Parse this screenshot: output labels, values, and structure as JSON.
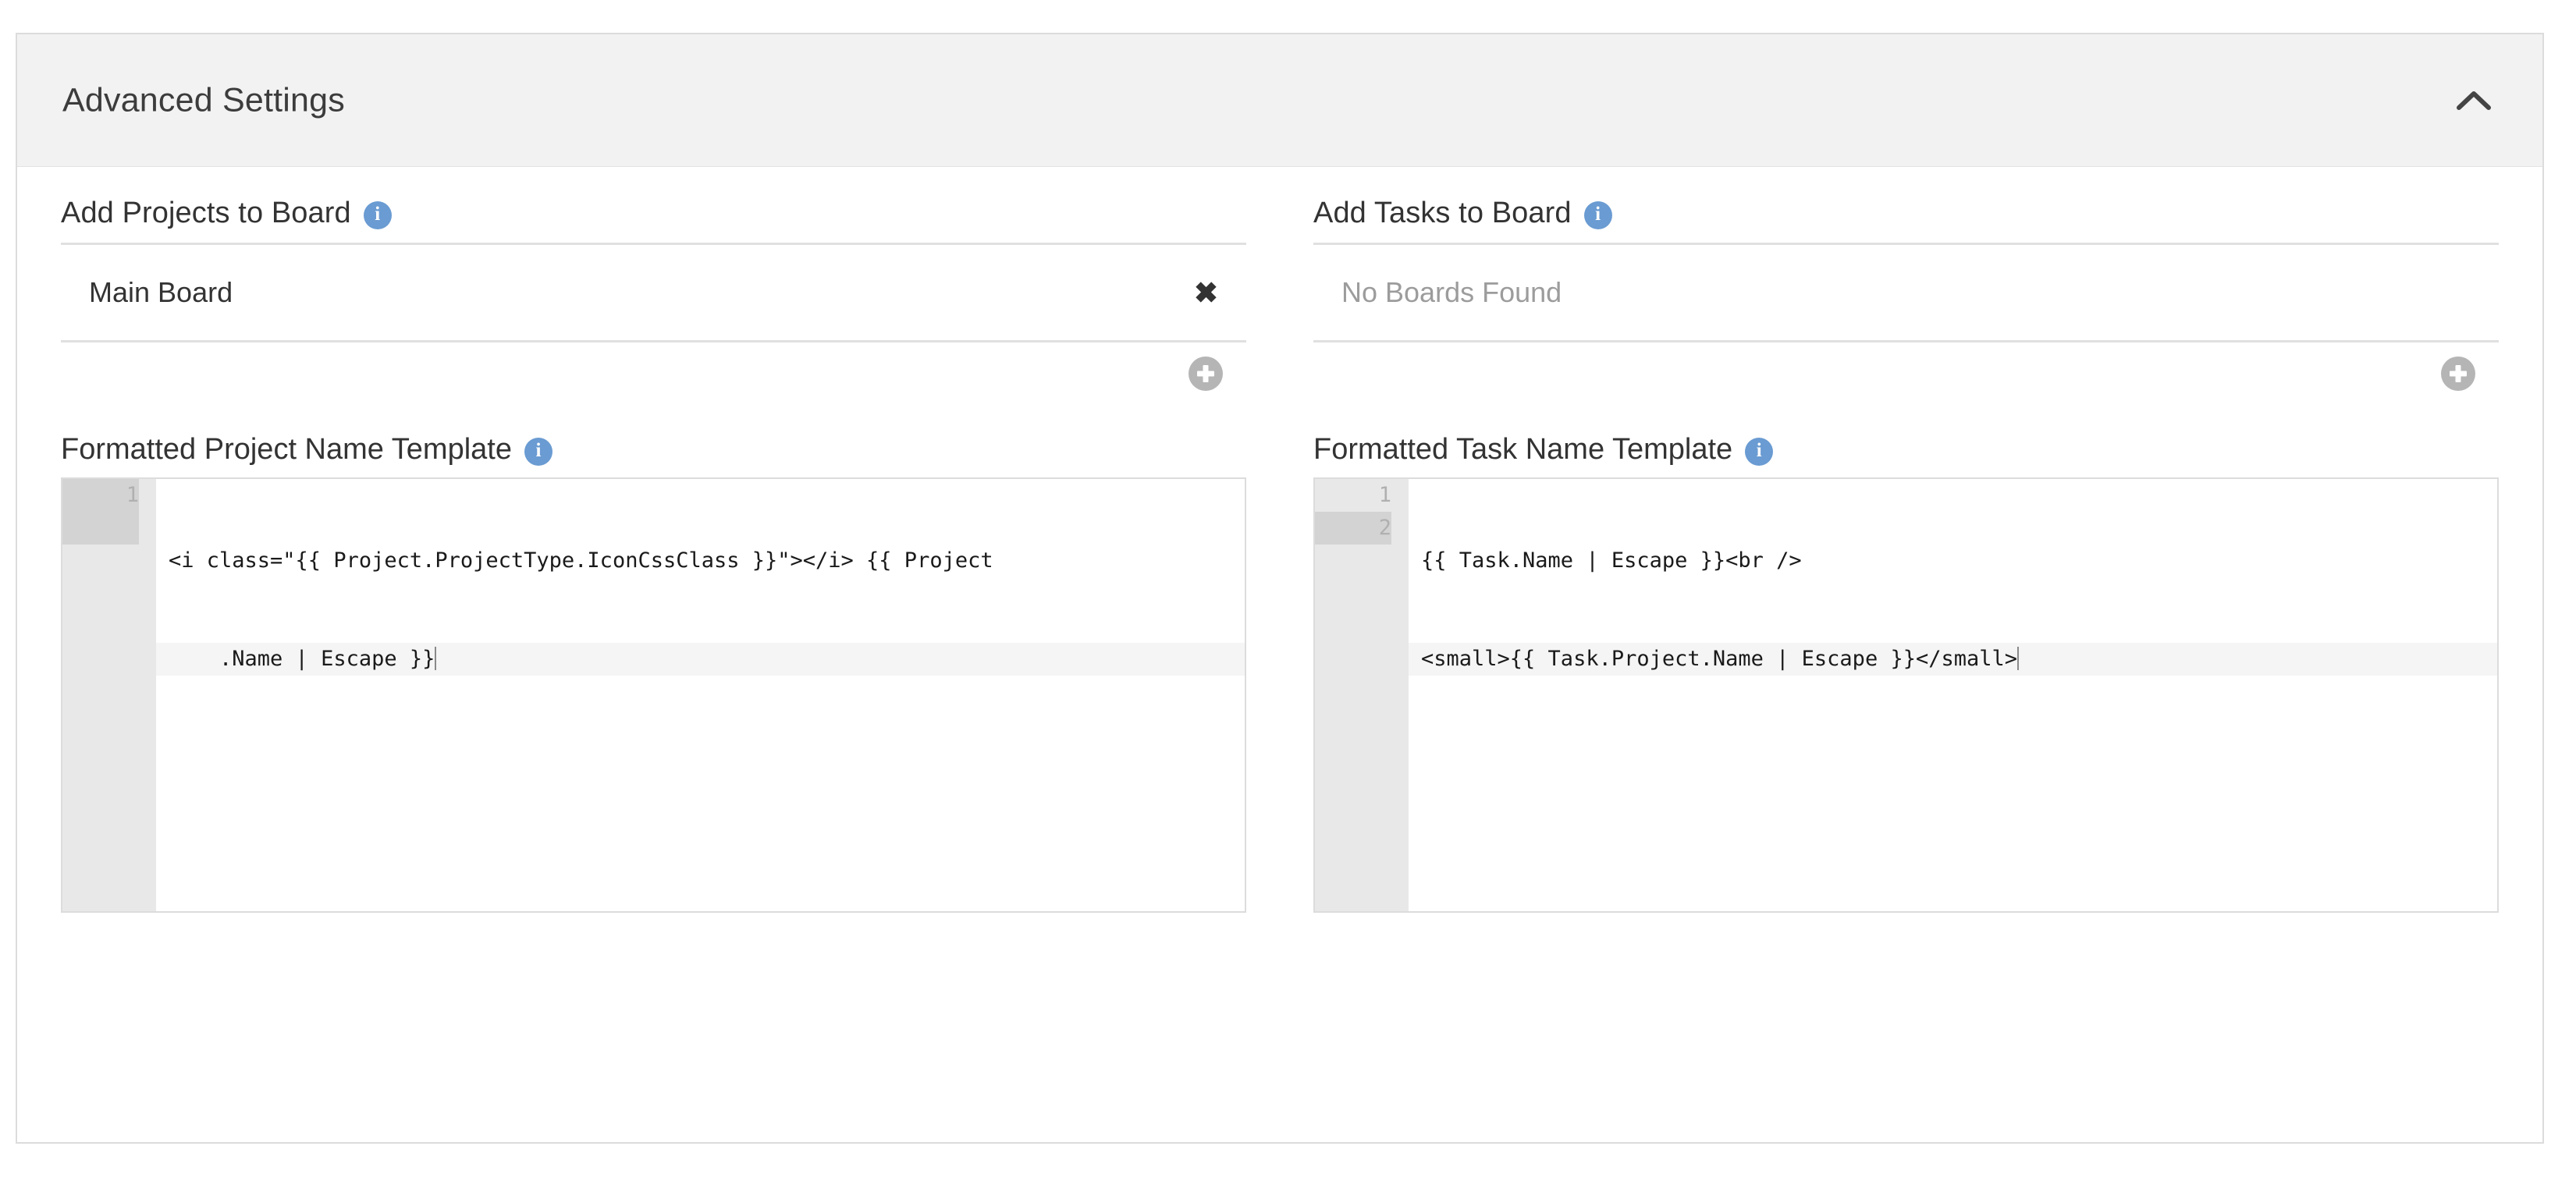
{
  "card": {
    "header": {
      "title": "Advanced Settings",
      "collapse_icon": "chevron-up-icon"
    }
  },
  "projects_section": {
    "title": "Add Projects to Board",
    "info_icon": "info-icon",
    "info_glyph": "i",
    "rows": [
      {
        "name": "Main Board",
        "remove_label": "✖",
        "empty": false
      }
    ],
    "add_button_icon": "plus-circle-icon"
  },
  "tasks_section": {
    "title": "Add Tasks to Board",
    "info_icon": "info-icon",
    "info_glyph": "i",
    "rows": [
      {
        "name": "No Boards Found",
        "empty": true
      }
    ],
    "add_button_icon": "plus-circle-icon"
  },
  "project_template": {
    "title": "Formatted Project Name Template",
    "info_icon": "info-icon",
    "info_glyph": "i",
    "editor": {
      "gutter_numbers": [
        "1"
      ],
      "lines": [
        {
          "num": "1",
          "text": "<i class=\"{{ Project.ProjectType.IconCssClass }}\"></i> {{ Project",
          "active": true,
          "wrapped": false,
          "caret": false
        },
        {
          "num": "",
          "text": "    .Name | Escape }}",
          "active": true,
          "wrapped": true,
          "caret": true
        }
      ]
    }
  },
  "task_template": {
    "title": "Formatted Task Name Template",
    "info_icon": "info-icon",
    "info_glyph": "i",
    "editor": {
      "gutter_numbers": [
        "1",
        "2"
      ],
      "lines": [
        {
          "num": "1",
          "text": "{{ Task.Name | Escape }}<br />",
          "active": false,
          "wrapped": false,
          "caret": false
        },
        {
          "num": "2",
          "text": "<small>{{ Task.Project.Name | Escape }}</small>",
          "active": true,
          "wrapped": false,
          "caret": true
        }
      ]
    }
  },
  "colors": {
    "header_bg": "#f2f2f2",
    "card_border": "#dcdcdc",
    "info_blue": "#6a9bd2",
    "add_gray": "#b5b5b5",
    "text": "#333333",
    "muted_text": "#9c9c9c",
    "gutter_bg": "#e8e8e8",
    "gutter_active": "#d3d3d3",
    "line_highlight": "#f5f5f5"
  }
}
